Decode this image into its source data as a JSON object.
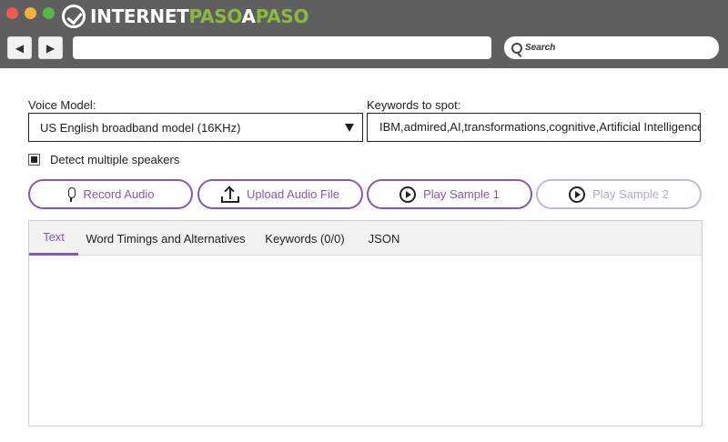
{
  "browser": {
    "logo": {
      "part1": "INTERNET",
      "part2": "PASO",
      "part3": "A",
      "part4": "PASO"
    },
    "nav": {
      "back_icon": "back-arrow-icon",
      "forward_icon": "forward-arrow-icon",
      "back_glyph": "◀",
      "forward_glyph": "▶"
    },
    "address_value": "",
    "search_placeholder": "Search"
  },
  "form": {
    "voice_model_label": "Voice Model:",
    "voice_model_value": "US English broadband model (16KHz)",
    "keywords_label": "Keywords to spot:",
    "keywords_value": "IBM,admired,AI,transformations,cognitive,Artificial Intelligence,da",
    "detect_speakers_label": "Detect multiple speakers",
    "detect_speakers_checked": true
  },
  "actions": [
    {
      "label": "Record Audio",
      "icon": "microphone-icon",
      "enabled": true
    },
    {
      "label": "Upload Audio File",
      "icon": "upload-icon",
      "enabled": true
    },
    {
      "label": "Play Sample 1",
      "icon": "play-icon",
      "enabled": true
    },
    {
      "label": "Play Sample 2",
      "icon": "play-icon",
      "enabled": false
    }
  ],
  "tabs": [
    {
      "label": "Text",
      "active": true
    },
    {
      "label": "Word Timings and Alternatives",
      "active": false
    },
    {
      "label": "Keywords (0/0)",
      "active": false
    },
    {
      "label": "JSON",
      "active": false
    }
  ],
  "colors": {
    "accent": "#8656b8",
    "accent_disabled": "#c9b4e0",
    "chrome": "#5f5f5f",
    "logo_green": "#8ab940"
  }
}
